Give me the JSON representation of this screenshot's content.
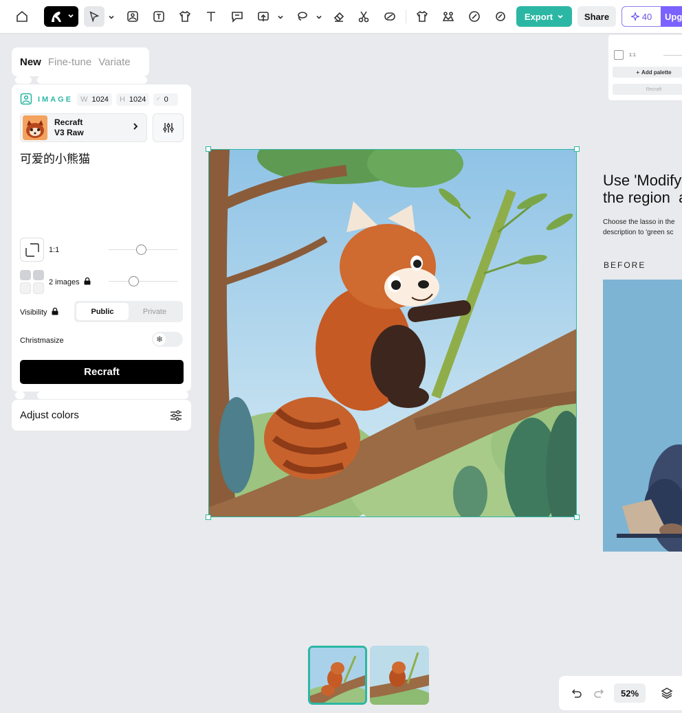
{
  "toolbar": {
    "export_label": "Export",
    "share_label": "Share",
    "credits": "40",
    "upgrade_label": "Upg"
  },
  "modes": [
    "New",
    "Fine-tune",
    "Variate"
  ],
  "image_settings": {
    "label": "IMAGE",
    "width_key": "W",
    "width": "1024",
    "height_key": "H",
    "height": "1024",
    "corner": "0"
  },
  "model": {
    "line1": "Recraft",
    "line2": "V3 Raw"
  },
  "prompt": "可爱的小熊猫",
  "aspect_ratio": "1:1",
  "images_count": "2 images",
  "visibility": {
    "label": "Visibility",
    "options": [
      "Public",
      "Private"
    ],
    "selected": "Public"
  },
  "christmasize": {
    "label": "Christmasize",
    "enabled": false
  },
  "recraft_button": "Recraft",
  "adjust_colors": "Adjust colors",
  "right_card": {
    "ratio": "1:1",
    "add_palette": "Add palette",
    "recraft": "Recraft"
  },
  "tip": {
    "title": "Use 'Modify\nthe region  a",
    "text": "Choose the lasso in the\ndescription to 'green sc",
    "before_label": "BEFORE"
  },
  "zoom": "52%",
  "colors": {
    "accent": "#2bb7a4",
    "upgrade": "#7b61ff",
    "canvas": "#e9eaed"
  }
}
